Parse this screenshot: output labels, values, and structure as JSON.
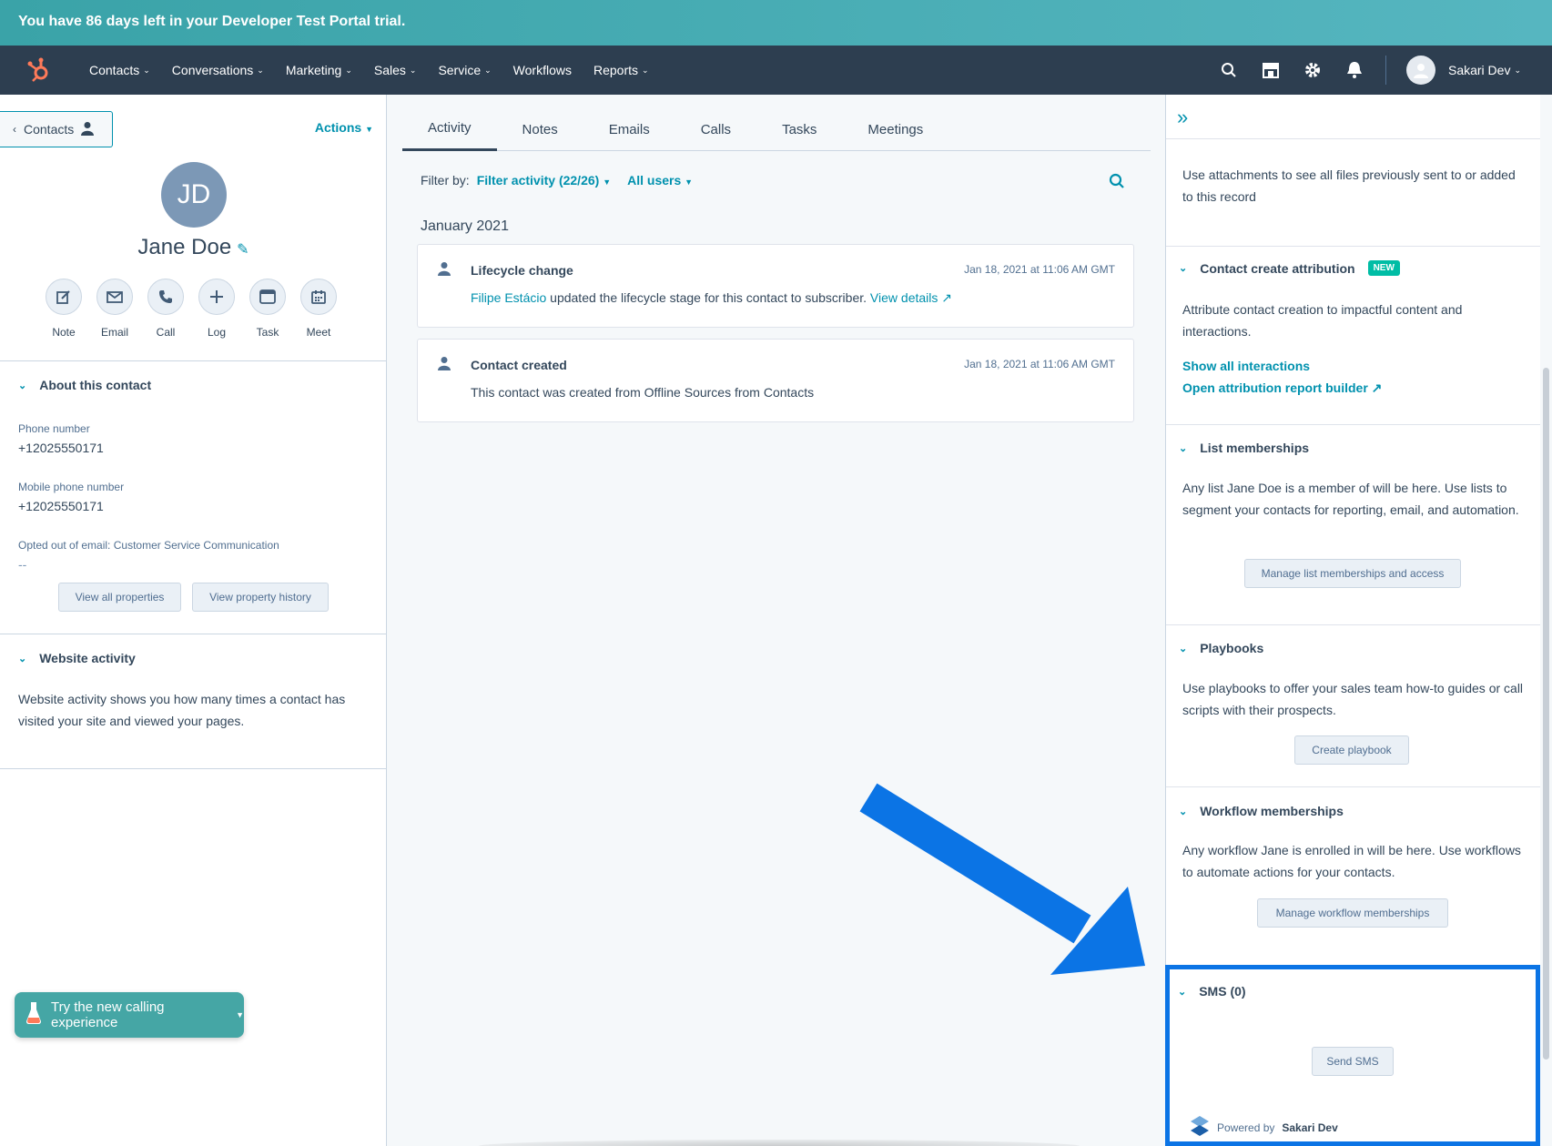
{
  "banner": {
    "text": "You have 86 days left in your Developer Test Portal trial."
  },
  "nav": {
    "items": [
      {
        "label": "Contacts",
        "dropdown": true
      },
      {
        "label": "Conversations",
        "dropdown": true
      },
      {
        "label": "Marketing",
        "dropdown": true
      },
      {
        "label": "Sales",
        "dropdown": true
      },
      {
        "label": "Service",
        "dropdown": true
      },
      {
        "label": "Workflows",
        "dropdown": false
      },
      {
        "label": "Reports",
        "dropdown": true
      }
    ],
    "user_name": "Sakari Dev",
    "icons": [
      "search-icon",
      "marketplace-icon",
      "settings-gear-icon",
      "notifications-bell-icon"
    ]
  },
  "left": {
    "back_label": "Contacts",
    "actions_label": "Actions",
    "initials": "JD",
    "name": "Jane Doe",
    "action_buttons": [
      {
        "label": "Note",
        "icon": "note-edit-icon"
      },
      {
        "label": "Email",
        "icon": "email-icon"
      },
      {
        "label": "Call",
        "icon": "phone-icon"
      },
      {
        "label": "Log",
        "icon": "plus-icon"
      },
      {
        "label": "Task",
        "icon": "task-icon"
      },
      {
        "label": "Meet",
        "icon": "calendar-icon"
      }
    ],
    "about": {
      "title": "About this contact",
      "props": [
        {
          "label": "Phone number",
          "value": "+12025550171"
        },
        {
          "label": "Mobile phone number",
          "value": "+12025550171"
        },
        {
          "label": "Opted out of email: Customer Service Communication",
          "value": "--"
        }
      ],
      "view_all": "View all properties",
      "view_history": "View property history"
    },
    "website": {
      "title": "Website activity",
      "text": "Website activity shows you how many times a contact has visited your site and viewed your pages."
    },
    "calling_btn": "Try the new calling experience"
  },
  "middle": {
    "tabs": [
      "Activity",
      "Notes",
      "Emails",
      "Calls",
      "Tasks",
      "Meetings"
    ],
    "active_tab": "Activity",
    "filter_label": "Filter by:",
    "filter_activity": "Filter activity (22/26)",
    "all_users": "All users",
    "month": "January 2021",
    "cards": [
      {
        "title": "Lifecycle change",
        "date": "Jan 18, 2021 at 11:06 AM GMT",
        "actor": "Filipe Estácio",
        "text": "updated the lifecycle stage for this contact to subscriber.",
        "link": "View details"
      },
      {
        "title": "Contact created",
        "date": "Jan 18, 2021 at 11:06 AM GMT",
        "text": "This contact was created from Offline Sources from Contacts"
      }
    ]
  },
  "right": {
    "attachments_text": "Use attachments to see all files previously sent to or added to this record",
    "attribution": {
      "title": "Contact create attribution",
      "badge": "NEW",
      "text": "Attribute contact creation to impactful content and interactions.",
      "link1": "Show all interactions",
      "link2": "Open attribution report builder"
    },
    "lists": {
      "title": "List memberships",
      "text": "Any list Jane Doe is a member of will be here. Use lists to segment your contacts for reporting, email, and automation.",
      "button": "Manage list memberships and access"
    },
    "playbooks": {
      "title": "Playbooks",
      "text": "Use playbooks to offer your sales team how-to guides or call scripts with their prospects.",
      "button": "Create playbook"
    },
    "workflows": {
      "title": "Workflow memberships",
      "text": "Any workflow Jane is enrolled in will be here. Use workflows to automate actions for your contacts.",
      "button": "Manage workflow memberships"
    },
    "sms": {
      "title": "SMS (0)",
      "button": "Send SMS",
      "powered_prefix": "Powered by",
      "powered_name": "Sakari Dev"
    }
  },
  "colors": {
    "accent": "#0091ae",
    "nav_bg": "#2d3e50",
    "highlight": "#0b74e5",
    "banner": "#4aaeb5"
  }
}
